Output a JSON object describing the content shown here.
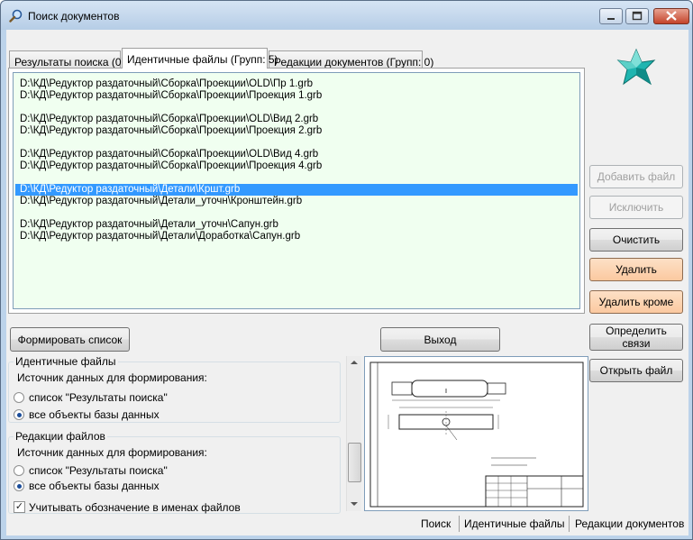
{
  "window": {
    "title": "Поиск документов"
  },
  "tabs": [
    {
      "label": "Результаты поиска (0)"
    },
    {
      "label": "Идентичные файлы (Групп: 5)"
    },
    {
      "label": "Редакции документов (Групп: 0)"
    }
  ],
  "file_list": [
    "D:\\КД\\Редуктор раздаточный\\Сборка\\Проекции\\OLD\\Пр 1.grb",
    "D:\\КД\\Редуктор раздаточный\\Сборка\\Проекции\\Проекция 1.grb",
    "D:\\КД\\Редуктор раздаточный\\Сборка\\Проекции\\OLD\\Вид 2.grb",
    "D:\\КД\\Редуктор раздаточный\\Сборка\\Проекции\\Проекция 2.grb",
    "D:\\КД\\Редуктор раздаточный\\Сборка\\Проекции\\OLD\\Вид 4.grb",
    "D:\\КД\\Редуктор раздаточный\\Сборка\\Проекции\\Проекция 4.grb",
    "D:\\КД\\Редуктор раздаточный\\Детали\\Кршт.grb",
    "D:\\КД\\Редуктор раздаточный\\Детали_уточн\\Кронштейн.grb",
    "D:\\КД\\Редуктор раздаточный\\Детали_уточн\\Сапун.grb",
    "D:\\КД\\Редуктор раздаточный\\Детали\\Доработка\\Сапун.grb"
  ],
  "selected_file": "D:\\КД\\Редуктор раздаточный\\Детали\\Кршт.grb",
  "buttons": {
    "add_file": "Добавить файл",
    "exclude": "Исключить",
    "clear": "Очистить",
    "delete": "Удалить",
    "delete_except": "Удалить кроме",
    "define_links": "Определить связи",
    "open_file": "Открыть файл",
    "form_list": "Формировать список",
    "exit": "Выход"
  },
  "identical_group": {
    "title": "Идентичные файлы",
    "source_label": "Источник данных для формирования:",
    "options": [
      "список \"Результаты поиска\"",
      "все объекты базы данных"
    ],
    "selected_option": "все объекты базы данных"
  },
  "revisions_group": {
    "title": "Редакции файлов",
    "source_label": "Источник данных для формирования:",
    "options": [
      "список \"Результаты поиска\"",
      "все объекты базы данных"
    ],
    "selected_option": "все объекты базы данных",
    "checkbox_label": "Учитывать обозначение в именах файлов",
    "checkbox_checked": true
  },
  "statusbar": [
    "Поиск",
    "Идентичные файлы",
    "Редакции документов"
  ],
  "colors": {
    "selection": "#3399ff",
    "list_background": "#f0fff0",
    "highlight_button": "#fbc9a0"
  }
}
